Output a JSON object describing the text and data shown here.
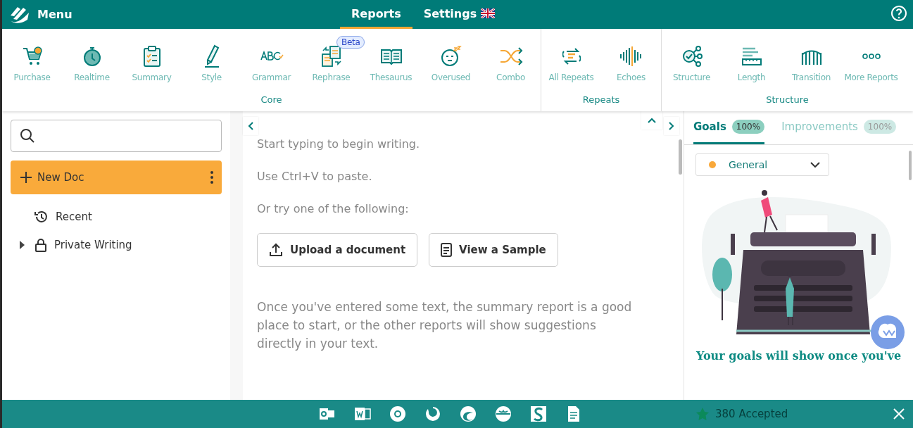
{
  "header": {
    "menu_label": "Menu",
    "tabs": [
      {
        "label": "Reports",
        "selected": true
      },
      {
        "label": "Settings",
        "selected": false
      }
    ]
  },
  "toolbar": {
    "groups": [
      {
        "name": "Core",
        "items": [
          {
            "label": "Purchase"
          },
          {
            "label": "Realtime"
          },
          {
            "label": "Summary"
          },
          {
            "label": "Style"
          },
          {
            "label": "Grammar"
          },
          {
            "label": "Rephrase",
            "badge": "Beta"
          },
          {
            "label": "Thesaurus"
          },
          {
            "label": "Overused"
          },
          {
            "label": "Combo"
          }
        ]
      },
      {
        "name": "Repeats",
        "items": [
          {
            "label": "All Repeats"
          },
          {
            "label": "Echoes"
          }
        ]
      },
      {
        "name": "Structure",
        "items": [
          {
            "label": "Structure"
          },
          {
            "label": "Length"
          },
          {
            "label": "Transition"
          },
          {
            "label": "More Reports"
          }
        ]
      }
    ]
  },
  "sidebar": {
    "new_doc": "New Doc",
    "tree": [
      {
        "label": "Recent",
        "kind": "link"
      },
      {
        "label": "Private Writing",
        "kind": "folder",
        "expanded": false
      }
    ]
  },
  "editor": {
    "hints": [
      "Start typing to begin writing.",
      "Use Ctrl+V to paste.",
      "Or try one of the following:"
    ],
    "buttons": [
      "Upload a document",
      "View a Sample"
    ],
    "note": "Once you've entered some text, the summary report is a good place to start, or the other reports will show suggestions directly in your text."
  },
  "goals_panel": {
    "tabs": [
      {
        "label": "Goals",
        "badge": "100%",
        "selected": true
      },
      {
        "label": "Improvements",
        "badge": "100%",
        "selected": false
      }
    ],
    "goal_select": {
      "value": "General",
      "color": "#f9a83a"
    },
    "message": "Your goals will show once you've",
    "accepted": "380 Accepted"
  }
}
